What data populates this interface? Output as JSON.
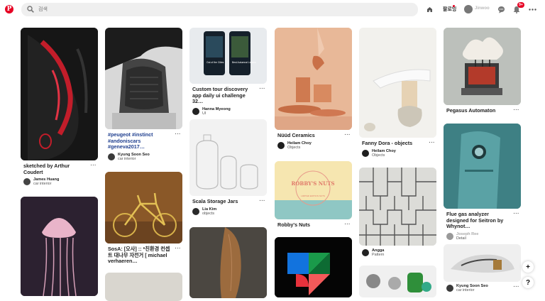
{
  "header": {
    "search_placeholder": "검색",
    "following_label": "팔로잉",
    "username": "Jinwoo",
    "notification_count": "9+",
    "brand_color": "#e60023"
  },
  "pins": [
    {
      "title": "sketched by Arthur Coudert",
      "user": "James Huang",
      "board": "car interior"
    },
    {
      "title": "#peugeot #instinct #andoniscars #geneva2017…",
      "user": "Kyung Soon Seo",
      "board": "car interior"
    },
    {
      "title": "SosA: [오사] :: *친환경 컨셉트 대나무 자전거 [ michael verhaeren…",
      "user": "",
      "board": ""
    },
    {
      "title": "Custom tour discovery app daily ui challenge 32…",
      "user": "Hanna Myeong",
      "board": "UI"
    },
    {
      "title": "Scala Storage Jars",
      "user": "Lia Kim",
      "board": "objects"
    },
    {
      "title": "Nüüd Ceramics",
      "user": "Heilam Choy",
      "board": "Objects"
    },
    {
      "title": "Robby's Nuts",
      "user": "",
      "board": ""
    },
    {
      "title": "Fanny Dora - objects",
      "user": "Heilam Choy",
      "board": "Objects"
    },
    {
      "title": "",
      "user": "Angga",
      "board": "Pattern"
    },
    {
      "title": "Pegasus Automaton",
      "user": "",
      "board": ""
    },
    {
      "title": "Flue gas analyzer designed for Seitron by Whynot…",
      "user": "Joseph Ree",
      "board": "Detail"
    },
    {
      "title": "",
      "user": "Kyung Soon Seo",
      "board": "car interior"
    }
  ],
  "app_screen": {
    "line1": "Out of the Cities",
    "line2": "Best Autumnal Leaves"
  },
  "logo_text": {
    "line1": "ROBBY'S NUTS",
    "line2": "LIMITED EDITION NUTS"
  },
  "fab": {
    "add": "+",
    "help": "?"
  },
  "more_glyph": "···"
}
